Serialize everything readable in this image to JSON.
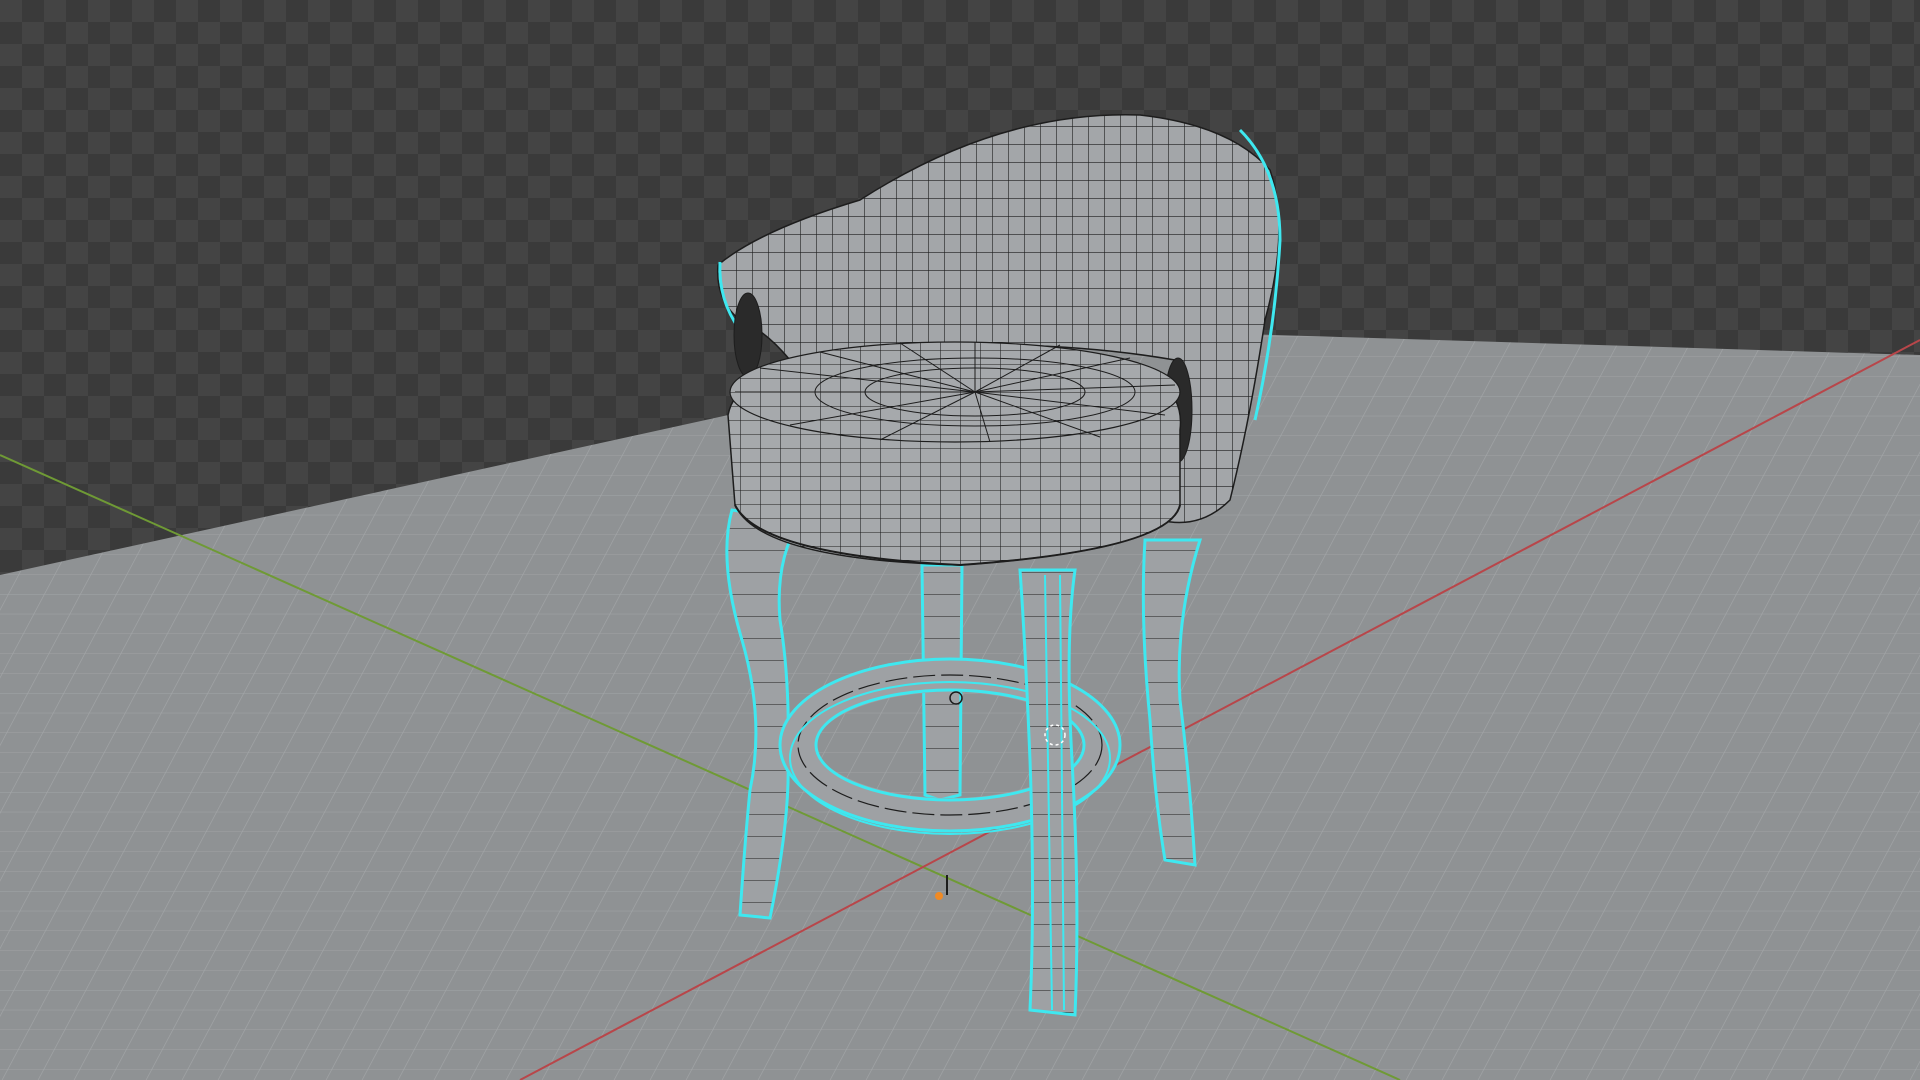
{
  "viewport": {
    "mode": "3d-viewport",
    "shading": "solid-with-wireframe-overlay",
    "background_color": "#3b3b3b",
    "checker_color": "#474747",
    "floor_color": "#8f9294",
    "floor_grid_color": "#a3a6a8",
    "x_axis_color": "#b8464a",
    "y_axis_color": "#6f9a35"
  },
  "object": {
    "name_icon": "bar-stool-model",
    "mesh_color": "#9fa3a6",
    "wire_color": "#1d1d1d",
    "selection_outline_color": "#3ee8f0",
    "origin_color": "#f08a24"
  }
}
